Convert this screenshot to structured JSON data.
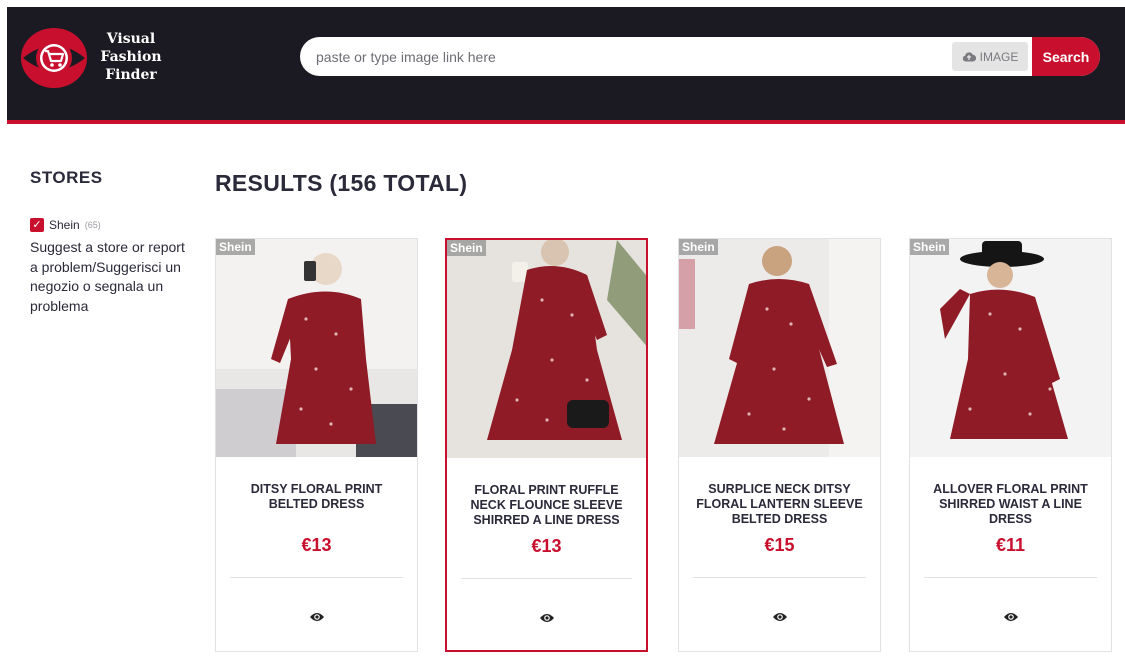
{
  "brand": {
    "line1": "Visual",
    "line2": "Fashion",
    "line3": "Finder"
  },
  "search": {
    "placeholder": "paste or type image link here",
    "image_label": "IMAGE",
    "submit_label": "Search"
  },
  "sidebar": {
    "title": "STORES",
    "filters": [
      {
        "name": "Shein",
        "count": "(65)",
        "checked": true
      }
    ],
    "suggest": "Suggest a store or report a problem/Suggerisci un negozio o segnala un problema"
  },
  "results": {
    "title": "RESULTS (156 TOTAL)",
    "products": [
      {
        "store": "Shein",
        "title": "DITSY FLORAL PRINT BELTED DRESS",
        "price": "€13"
      },
      {
        "store": "Shein",
        "title": "FLORAL PRINT RUFFLE NECK FLOUNCE SLEEVE SHIRRED A LINE DRESS",
        "price": "€13"
      },
      {
        "store": "Shein",
        "title": "SURPLICE NECK DITSY FLORAL LANTERN SLEEVE BELTED DRESS",
        "price": "€15"
      },
      {
        "store": "Shein",
        "title": "ALLOVER FLORAL PRINT SHIRRED WAIST A LINE DRESS",
        "price": "€11"
      }
    ]
  },
  "colors": {
    "accent": "#c8102e",
    "header_bg": "#1b1a22",
    "text": "#2a2a3a",
    "dress": "#8e1b25"
  },
  "icons": {
    "logo": "shopping-cart-icon",
    "upload": "cloud-upload-icon",
    "view": "eye-icon",
    "check": "checkmark-icon"
  }
}
